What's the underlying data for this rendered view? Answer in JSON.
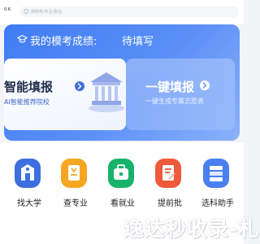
{
  "topbar": {
    "city": "0.6",
    "search_placeholder": "搜院校/专业/职业"
  },
  "hero": {
    "score_label": "我的模考成绩:",
    "score_value": "待填写",
    "card_smart": {
      "title": "智能填报",
      "subtitle": "AI智能推荐院校"
    },
    "card_quick": {
      "title": "一键填报",
      "subtitle": "一键生成专属志愿表"
    }
  },
  "quick_links": [
    {
      "label": "找大学",
      "icon": "university-icon",
      "color": "#3d6fe0"
    },
    {
      "label": "查专业",
      "icon": "major-book-icon",
      "color": "#f5a623"
    },
    {
      "label": "看就业",
      "icon": "briefcase-icon",
      "color": "#18b36b"
    },
    {
      "label": "提前批",
      "icon": "early-batch-icon",
      "color": "#ef5a3a"
    },
    {
      "label": "选科助手",
      "icon": "subject-books-icon",
      "color": "#4a7ff0"
    }
  ],
  "watermark": "逸达秒收录-札"
}
